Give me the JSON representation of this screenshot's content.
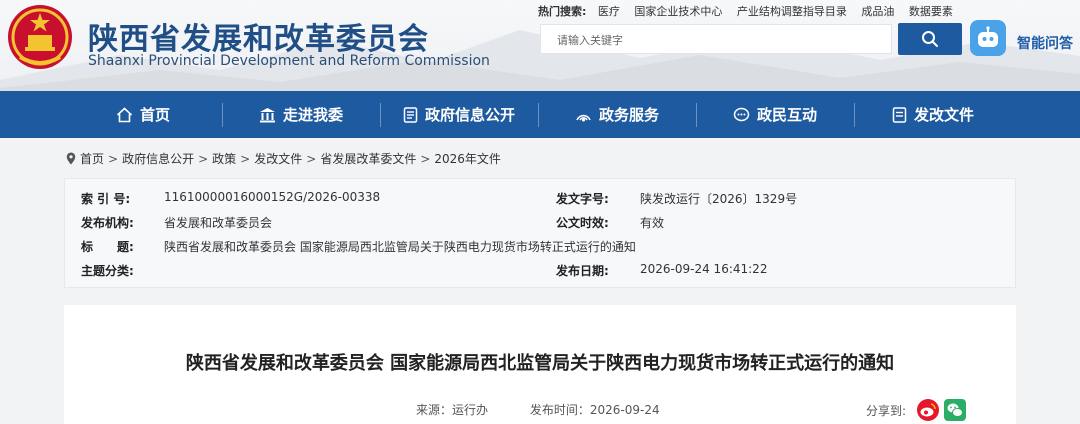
{
  "header": {
    "site_name_cn": "陕西省发展和改革委员会",
    "site_name_en": "Shaanxi Provincial Development and Reform Commission",
    "hot_search": {
      "label": "热门搜索:",
      "links": [
        "医疗",
        "国家企业技术中心",
        "产业结构调整指导目录",
        "成品油",
        "数据要素"
      ]
    },
    "search": {
      "placeholder": "请输入关键字"
    },
    "ai_label": "智能问答",
    "colors": {
      "brand_blue": "#1e5aa0",
      "title_blue": "#1f4f86"
    }
  },
  "nav": {
    "items": [
      {
        "label": "首页",
        "icon": "home-icon"
      },
      {
        "label": "走进我委",
        "icon": "building-icon"
      },
      {
        "label": "政府信息公开",
        "icon": "document-icon"
      },
      {
        "label": "政务服务",
        "icon": "service-icon"
      },
      {
        "label": "政民互动",
        "icon": "chat-icon"
      },
      {
        "label": "发改文件",
        "icon": "file-icon"
      }
    ]
  },
  "breadcrumb": [
    "首页",
    "政府信息公开",
    "政策",
    "发改文件",
    "省发展改革委文件",
    "2026年文件"
  ],
  "meta": {
    "index_no": {
      "label": "索 引 号:",
      "value": "11610000016000152G/2026-00338"
    },
    "doc_no": {
      "label": "发文字号:",
      "value": "陕发改运行〔2026〕1329号"
    },
    "publisher": {
      "label": "发布机构:",
      "value": "省发展和改革委员会"
    },
    "validity": {
      "label": "公文时效:",
      "value": "有效"
    },
    "title": {
      "label": "标　　题:",
      "value": "陕西省发展和改革委员会 国家能源局西北监管局关于陕西电力现货市场转正式运行的通知"
    },
    "category": {
      "label": "主题分类:",
      "value": ""
    },
    "publish_date": {
      "label": "发布日期:",
      "value": "2026-09-24 16:41:22"
    }
  },
  "article": {
    "title": "陕西省发展和改革委员会 国家能源局西北监管局关于陕西电力现货市场转正式运行的通知",
    "source": "来源：运行办",
    "time": "发布时间：2026-09-24",
    "share_label": "分享到:"
  }
}
